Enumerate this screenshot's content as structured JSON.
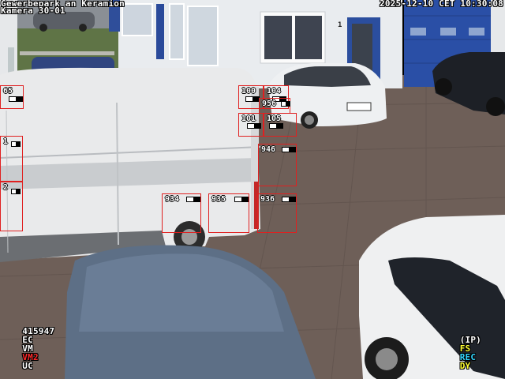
{
  "osd": {
    "site_name": "Gewerbepark an Keramion",
    "camera_name": "Kamera 30-01",
    "datetime": "2025-12-10 CET 10:30:08",
    "building_number": "1"
  },
  "status_bar": {
    "frame_counter": "415947",
    "left_flags": [
      {
        "label": "EC",
        "color": "#ffffff"
      },
      {
        "label": "VM",
        "color": "#ffffff"
      },
      {
        "label": "VM2",
        "color": "#ff2a2a"
      },
      {
        "label": "UC",
        "color": "#ffffff"
      }
    ],
    "right_flags": [
      {
        "label": "(IP)",
        "color": "#ffffff"
      },
      {
        "label": "FS",
        "color": "#ffff33"
      },
      {
        "label": "REC",
        "color": "#33d6ff"
      },
      {
        "label": "DY",
        "color": "#ffff33"
      }
    ]
  },
  "zones": [
    {
      "id": "65"
    },
    {
      "id": "1"
    },
    {
      "id": "2"
    },
    {
      "id": "100"
    },
    {
      "id": "104"
    },
    {
      "id": "956"
    },
    {
      "id": "101"
    },
    {
      "id": "105"
    },
    {
      "id": "946"
    },
    {
      "id": "934"
    },
    {
      "id": "935"
    },
    {
      "id": "936"
    }
  ],
  "colors": {
    "zone_border": "#e02020",
    "osd_text": "#ffffff",
    "garage_door": "#2a4fa6"
  }
}
